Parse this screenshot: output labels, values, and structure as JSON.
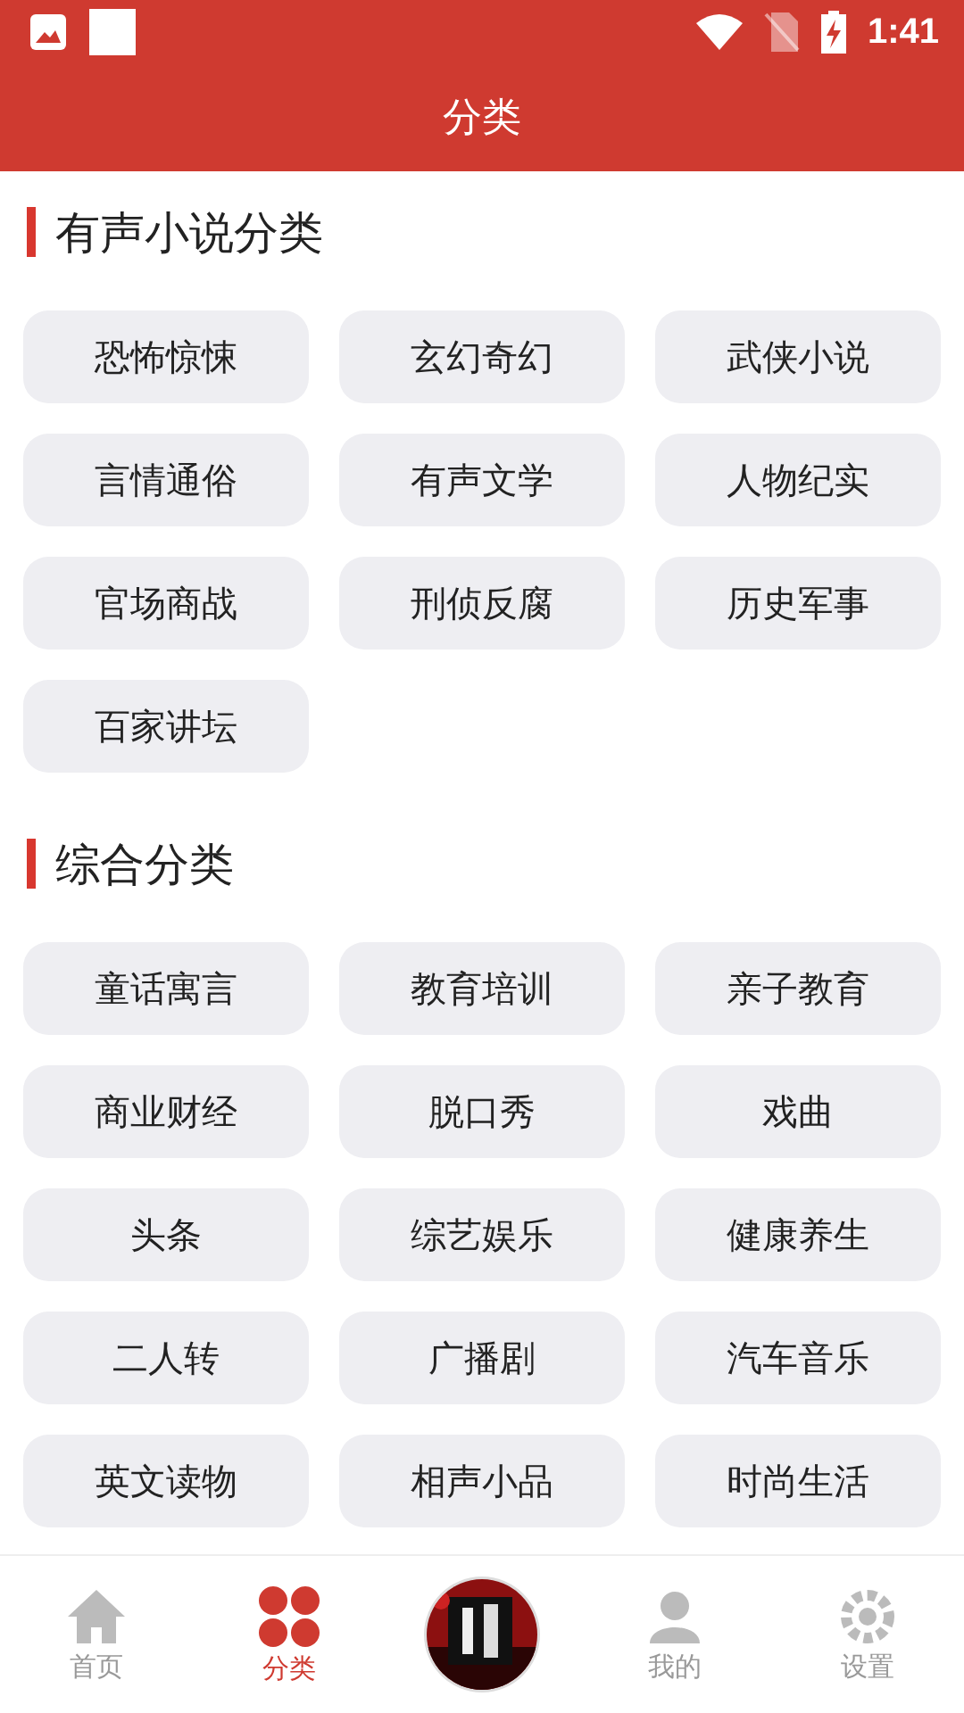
{
  "status_bar": {
    "time": "1:41"
  },
  "header": {
    "title": "分类"
  },
  "sections": [
    {
      "title": "有声小说分类",
      "items": [
        "恐怖惊悚",
        "玄幻奇幻",
        "武侠小说",
        "言情通俗",
        "有声文学",
        "人物纪实",
        "官场商战",
        "刑侦反腐",
        "历史军事",
        "百家讲坛"
      ]
    },
    {
      "title": "综合分类",
      "items": [
        "童话寓言",
        "教育培训",
        "亲子教育",
        "商业财经",
        "脱口秀",
        "戏曲",
        "头条",
        "综艺娱乐",
        "健康养生",
        "二人转",
        "广播剧",
        "汽车音乐",
        "英文读物",
        "相声小品",
        "时尚生活"
      ]
    }
  ],
  "tab_bar": [
    {
      "kind": "home",
      "label": "首页",
      "selected": false
    },
    {
      "kind": "category",
      "label": "分类",
      "selected": true
    },
    {
      "kind": "player"
    },
    {
      "kind": "mine",
      "label": "我的",
      "selected": false
    },
    {
      "kind": "settings",
      "label": "设置",
      "selected": false
    }
  ]
}
